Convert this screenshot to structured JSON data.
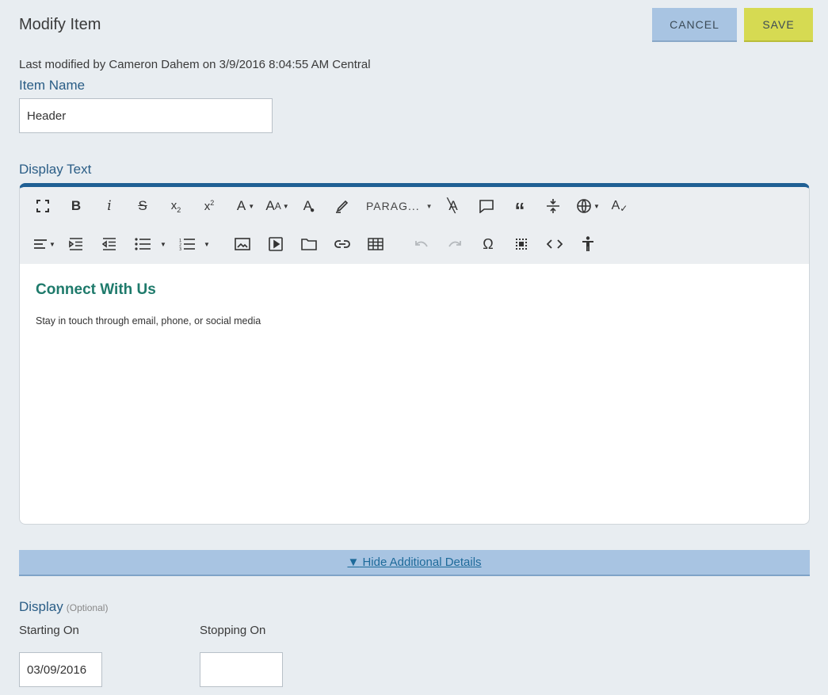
{
  "header": {
    "title": "Modify Item",
    "cancel_label": "CANCEL",
    "save_label": "SAVE"
  },
  "last_modified": "Last modified by Cameron Dahem on 3/9/2016 8:04:55 AM Central",
  "item_name": {
    "label": "Item Name",
    "value": "Header"
  },
  "display_text": {
    "label": "Display Text",
    "toolbar": {
      "paragraph_format": "PARAG..."
    },
    "content": {
      "heading": "Connect With Us",
      "paragraph": "Stay in touch through email, phone, or social media"
    }
  },
  "details_toggle": {
    "arrow": "▼",
    "label": "Hide Additional Details"
  },
  "display": {
    "label": "Display",
    "optional": "(Optional)",
    "starting_on_label": "Starting On",
    "starting_on_value": "03/09/2016",
    "stopping_on_label": "Stopping On",
    "stopping_on_value": ""
  },
  "colors": {
    "accent": "#1f5f94",
    "cancel_bg": "#a8c4e2",
    "save_bg": "#d6da52",
    "heading": "#1e7a6b"
  }
}
